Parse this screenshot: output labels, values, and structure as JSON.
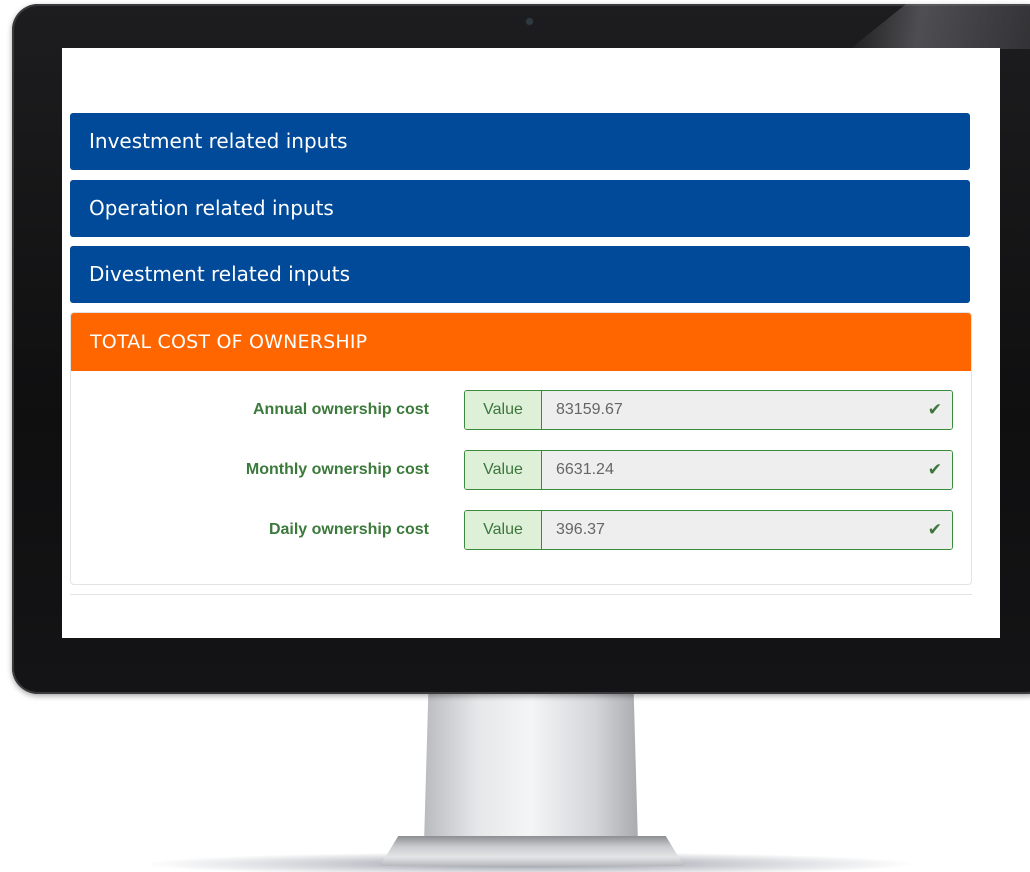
{
  "sections": {
    "investment_label": "Investment related inputs",
    "operation_label": "Operation related inputs",
    "divestment_label": "Divestment related inputs"
  },
  "tco": {
    "title": "TOTAL COST OF OWNERSHIP",
    "rows": [
      {
        "label": "Annual ownership cost",
        "addon": "Value",
        "value": "83159.67"
      },
      {
        "label": "Monthly ownership cost",
        "addon": "Value",
        "value": "6631.24"
      },
      {
        "label": "Daily ownership cost",
        "addon": "Value",
        "value": "396.37"
      }
    ]
  },
  "colors": {
    "section_bar": "#004a99",
    "tco_header": "#ff6600",
    "success_green": "#3c763d",
    "addon_bg": "#dff0d8"
  },
  "icons": {
    "valid": "check-icon"
  }
}
